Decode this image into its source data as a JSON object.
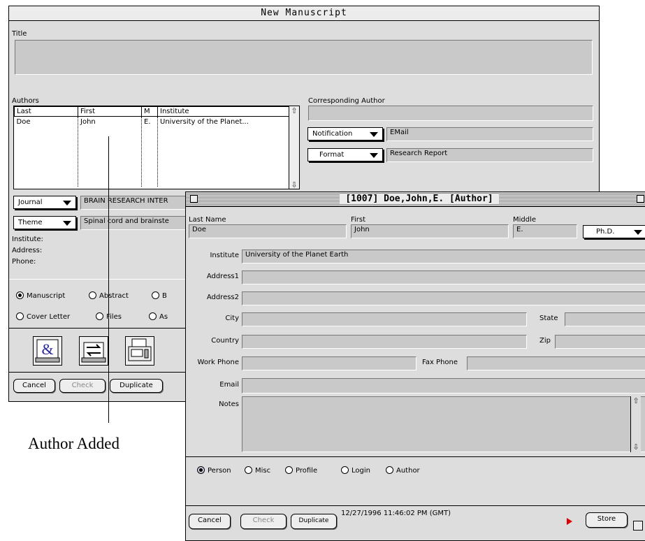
{
  "manuscript_window": {
    "title": "New Manuscript",
    "title_label": "Title",
    "title_value": "",
    "authors_label": "Authors",
    "columns": [
      "Last",
      "First",
      "M",
      "Institute"
    ],
    "authors": [
      {
        "last": "Doe",
        "first": "John",
        "middle": "E.",
        "institute": "University of the Planet..."
      }
    ],
    "corresponding_author_label": "Corresponding Author",
    "corresponding_author_value": "",
    "notification_label": "Notification",
    "notification_value": "EMail",
    "format_label": "Format",
    "format_value": "Research Report",
    "journal_label": "Journal",
    "journal_value": "BRAIN RESEARCH INTER",
    "theme_label": "Theme",
    "theme_value": "Spinal cord and brainste",
    "institute_label": "Institute:",
    "address_label": "Address:",
    "phone_label": "Phone:",
    "radios": {
      "manuscript": "Manuscript",
      "abstract": "Abstract",
      "b_partial": "B",
      "cover_letter": "Cover Letter",
      "files": "Files",
      "as_partial": "As"
    },
    "cancel_label": "Cancel",
    "check_label": "Check",
    "duplicate_label": "Duplicate"
  },
  "author_window": {
    "title": "[1007] Doe,John,E. [Author]",
    "last_name_label": "Last Name",
    "last_name_value": "Doe",
    "first_label": "First",
    "first_value": "John",
    "middle_label": "Middle",
    "middle_value": "E.",
    "degree_value": "Ph.D.",
    "institute_label": "Institute",
    "institute_value": "University of the Planet Earth",
    "address1_label": "Address1",
    "address2_label": "Address2",
    "city_label": "City",
    "state_label": "State",
    "country_label": "Country",
    "zip_label": "Zip",
    "work_phone_label": "Work Phone",
    "fax_phone_label": "Fax Phone",
    "email_label": "Email",
    "notes_label": "Notes",
    "radios": {
      "person": "Person",
      "misc": "Misc",
      "profile": "Profile",
      "login": "Login",
      "author": "Author"
    },
    "cancel_label": "Cancel",
    "check_label": "Check",
    "duplicate_label": "Duplicate",
    "timestamp": "12/27/1996 11:46:02 PM (GMT)",
    "store_label": "Store"
  },
  "caption": "Author Added"
}
